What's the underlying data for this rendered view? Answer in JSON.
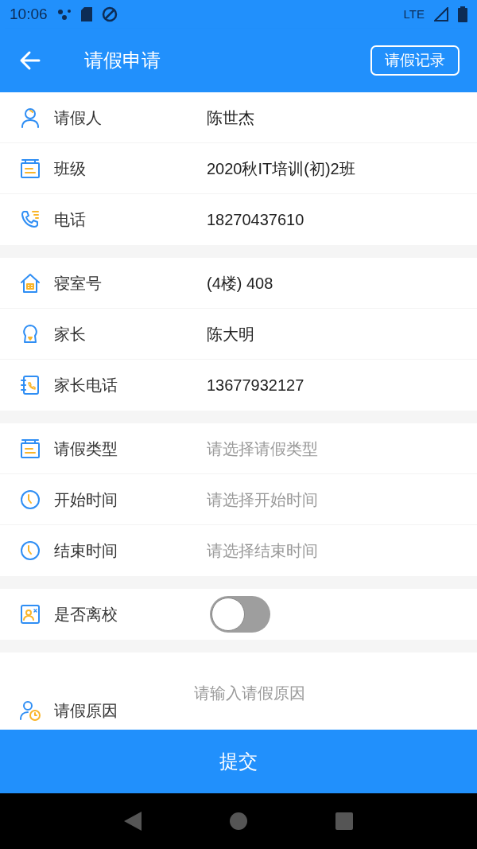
{
  "status_bar": {
    "time": "10:06",
    "network": "LTE"
  },
  "app_bar": {
    "title": "请假申请",
    "action": "请假记录"
  },
  "groups": [
    {
      "rows": [
        {
          "kind": "text",
          "label": "请假人",
          "value": "陈世杰"
        },
        {
          "kind": "text",
          "label": "班级",
          "value": "2020秋IT培训(初)2班"
        },
        {
          "kind": "text",
          "label": "电话",
          "value": "18270437610"
        }
      ]
    },
    {
      "rows": [
        {
          "kind": "text",
          "label": "寝室号",
          "value": "(4楼) 408"
        },
        {
          "kind": "text",
          "label": "家长",
          "value": "陈大明"
        },
        {
          "kind": "text",
          "label": "家长电话",
          "value": "13677932127"
        }
      ]
    },
    {
      "rows": [
        {
          "kind": "select",
          "label": "请假类型",
          "placeholder": "请选择请假类型"
        },
        {
          "kind": "select",
          "label": "开始时间",
          "placeholder": "请选择开始时间"
        },
        {
          "kind": "select",
          "label": "结束时间",
          "placeholder": "请选择结束时间"
        }
      ]
    },
    {
      "rows": [
        {
          "kind": "switch",
          "label": "是否离校",
          "on": false
        }
      ]
    },
    {
      "rows": [
        {
          "kind": "textarea",
          "label": "请假原因",
          "placeholder": "请输入请假原因"
        }
      ]
    }
  ],
  "submit": "提交"
}
